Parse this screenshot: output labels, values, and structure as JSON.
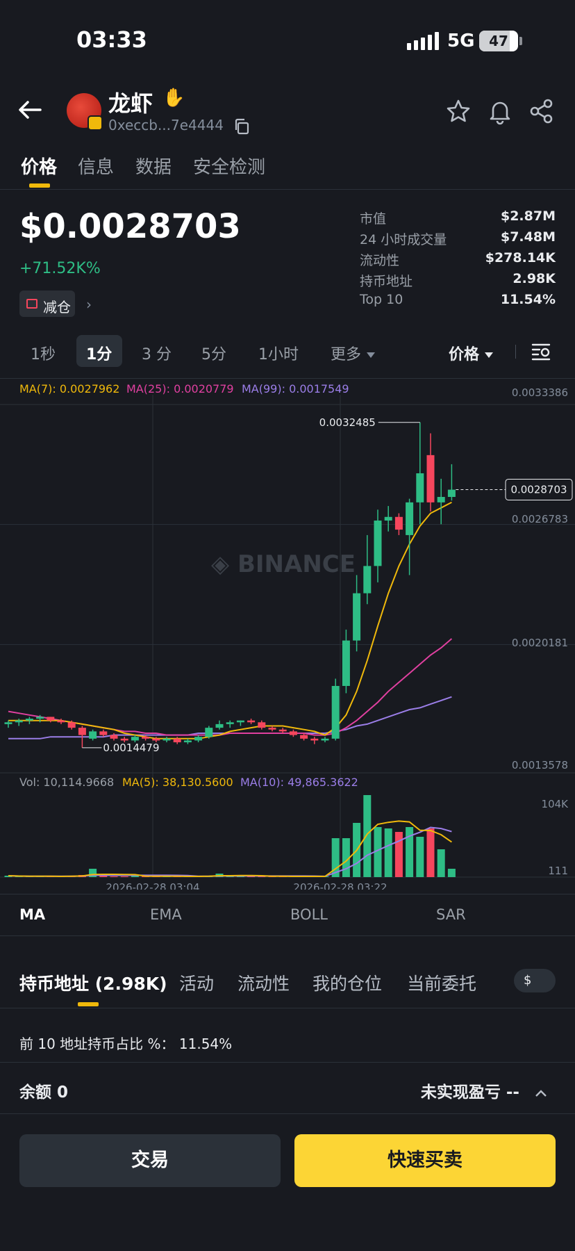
{
  "status": {
    "time": "03:33",
    "network": "5G",
    "battery": "47"
  },
  "token": {
    "name": "龙虾",
    "address": "0xeccb...7e4444"
  },
  "tabs": [
    "价格",
    "信息",
    "数据",
    "安全检测"
  ],
  "price": {
    "value": "$0.0028703",
    "change": "+71.52K%",
    "reduce_label": "减仓"
  },
  "stats": [
    {
      "label": "市值",
      "value": "$2.87M"
    },
    {
      "label": "24 小时成交量",
      "value": "$7.48M"
    },
    {
      "label": "流动性",
      "value": "$278.14K"
    },
    {
      "label": "持币地址",
      "value": "2.98K"
    },
    {
      "label": "Top 10",
      "value": "11.54%"
    }
  ],
  "timeframes": {
    "items": [
      "1秒",
      "1分",
      "3 分",
      "5分",
      "1小时"
    ],
    "more": "更多",
    "price_toggle": "价格"
  },
  "colors": {
    "up": "#2ebd85",
    "down": "#f6465d",
    "accent": "#fcd535",
    "ma7": "#f0b90b",
    "ma25": "#e040a0",
    "ma99": "#9b7ee8"
  },
  "chart_data": {
    "type": "candlestick",
    "ma_legend": {
      "ma7": "MA(7): 0.0027962",
      "ma25": "MA(25): 0.0020779",
      "ma99": "MA(99): 0.0017549"
    },
    "y_ticks": [
      "0.0033386",
      "0.0026783",
      "0.0020181",
      "0.0013578"
    ],
    "y_range": [
      0.0013578,
      0.0033386
    ],
    "current_price": "0.0028703",
    "high_label": "0.0032485",
    "low_label": "0.0014479",
    "watermark": "BINANCE",
    "x_labels": [
      "2026-02-28 03:04",
      "2026-02-28 03:22"
    ],
    "candles": [
      {
        "o": 0.00158,
        "h": 0.0016,
        "l": 0.00156,
        "c": 0.00159
      },
      {
        "o": 0.00159,
        "h": 0.00161,
        "l": 0.00157,
        "c": 0.0016
      },
      {
        "o": 0.0016,
        "h": 0.00162,
        "l": 0.00158,
        "c": 0.00161
      },
      {
        "o": 0.00161,
        "h": 0.00163,
        "l": 0.00159,
        "c": 0.00162
      },
      {
        "o": 0.00162,
        "h": 0.00162,
        "l": 0.00159,
        "c": 0.0016
      },
      {
        "o": 0.0016,
        "h": 0.00161,
        "l": 0.00158,
        "c": 0.00159
      },
      {
        "o": 0.00159,
        "h": 0.0016,
        "l": 0.00155,
        "c": 0.00156
      },
      {
        "o": 0.00156,
        "h": 0.00157,
        "l": 0.00145,
        "c": 0.00152
      },
      {
        "o": 0.0015,
        "h": 0.00155,
        "l": 0.00149,
        "c": 0.00154
      },
      {
        "o": 0.00154,
        "h": 0.00155,
        "l": 0.00151,
        "c": 0.00152
      },
      {
        "o": 0.00152,
        "h": 0.00153,
        "l": 0.00149,
        "c": 0.0015
      },
      {
        "o": 0.0015,
        "h": 0.00151,
        "l": 0.00148,
        "c": 0.00149
      },
      {
        "o": 0.00149,
        "h": 0.00152,
        "l": 0.00148,
        "c": 0.00151
      },
      {
        "o": 0.00151,
        "h": 0.00152,
        "l": 0.00149,
        "c": 0.0015
      },
      {
        "o": 0.0015,
        "h": 0.00151,
        "l": 0.00148,
        "c": 0.00149
      },
      {
        "o": 0.00149,
        "h": 0.00151,
        "l": 0.00148,
        "c": 0.0015
      },
      {
        "o": 0.0015,
        "h": 0.00151,
        "l": 0.00147,
        "c": 0.00148
      },
      {
        "o": 0.00148,
        "h": 0.0015,
        "l": 0.00147,
        "c": 0.00149
      },
      {
        "o": 0.00149,
        "h": 0.00152,
        "l": 0.00148,
        "c": 0.00151
      },
      {
        "o": 0.00151,
        "h": 0.00157,
        "l": 0.0015,
        "c": 0.00156
      },
      {
        "o": 0.00156,
        "h": 0.0016,
        "l": 0.00155,
        "c": 0.00158
      },
      {
        "o": 0.00158,
        "h": 0.0016,
        "l": 0.00156,
        "c": 0.00159
      },
      {
        "o": 0.00159,
        "h": 0.0016,
        "l": 0.00157,
        "c": 0.0016
      },
      {
        "o": 0.0016,
        "h": 0.00161,
        "l": 0.00158,
        "c": 0.00159
      },
      {
        "o": 0.00159,
        "h": 0.0016,
        "l": 0.00155,
        "c": 0.00156
      },
      {
        "o": 0.00156,
        "h": 0.00157,
        "l": 0.00154,
        "c": 0.00155
      },
      {
        "o": 0.00155,
        "h": 0.00156,
        "l": 0.00153,
        "c": 0.00154
      },
      {
        "o": 0.00154,
        "h": 0.00155,
        "l": 0.00151,
        "c": 0.00152
      },
      {
        "o": 0.00152,
        "h": 0.00153,
        "l": 0.00149,
        "c": 0.0015
      },
      {
        "o": 0.0015,
        "h": 0.00151,
        "l": 0.00147,
        "c": 0.00149
      },
      {
        "o": 0.00149,
        "h": 0.00151,
        "l": 0.00148,
        "c": 0.0015
      },
      {
        "o": 0.0015,
        "h": 0.00183,
        "l": 0.00149,
        "c": 0.00179
      },
      {
        "o": 0.00179,
        "h": 0.0021,
        "l": 0.00175,
        "c": 0.00204
      },
      {
        "o": 0.00204,
        "h": 0.0024,
        "l": 0.00198,
        "c": 0.0023
      },
      {
        "o": 0.0023,
        "h": 0.00262,
        "l": 0.00224,
        "c": 0.00245
      },
      {
        "o": 0.00245,
        "h": 0.00276,
        "l": 0.00236,
        "c": 0.0027
      },
      {
        "o": 0.0027,
        "h": 0.00278,
        "l": 0.00264,
        "c": 0.00272
      },
      {
        "o": 0.00272,
        "h": 0.00274,
        "l": 0.00262,
        "c": 0.00265
      },
      {
        "o": 0.00262,
        "h": 0.00282,
        "l": 0.0024,
        "c": 0.0028
      },
      {
        "o": 0.0028,
        "h": 0.00324,
        "l": 0.00268,
        "c": 0.00296
      },
      {
        "o": 0.00306,
        "h": 0.00318,
        "l": 0.00275,
        "c": 0.0028
      },
      {
        "o": 0.0028,
        "h": 0.00293,
        "l": 0.00268,
        "c": 0.00283
      },
      {
        "o": 0.00283,
        "h": 0.00301,
        "l": 0.00281,
        "c": 0.00287
      }
    ],
    "ma7": [
      0.0016,
      0.0016,
      0.0016,
      0.0016,
      0.0016,
      0.0016,
      0.00159,
      0.00158,
      0.00157,
      0.00156,
      0.00155,
      0.00153,
      0.00152,
      0.00151,
      0.0015,
      0.0015,
      0.0015,
      0.0015,
      0.0015,
      0.00151,
      0.00152,
      0.00154,
      0.00155,
      0.00156,
      0.00157,
      0.00157,
      0.00157,
      0.00156,
      0.00155,
      0.00154,
      0.00152,
      0.00156,
      0.00163,
      0.00176,
      0.00193,
      0.00212,
      0.0023,
      0.00245,
      0.00257,
      0.00267,
      0.00274,
      0.00277,
      0.0028
    ],
    "ma25": [
      0.00165,
      0.00164,
      0.00163,
      0.00162,
      0.00161,
      0.0016,
      0.00159,
      0.00158,
      0.00157,
      0.00156,
      0.00155,
      0.00154,
      0.00154,
      0.00153,
      0.00153,
      0.00152,
      0.00152,
      0.00152,
      0.00152,
      0.00152,
      0.00152,
      0.00153,
      0.00153,
      0.00153,
      0.00153,
      0.00153,
      0.00153,
      0.00153,
      0.00153,
      0.00152,
      0.00152,
      0.00153,
      0.00156,
      0.0016,
      0.00165,
      0.0017,
      0.00176,
      0.00181,
      0.00186,
      0.00191,
      0.00196,
      0.002,
      0.00205
    ],
    "ma99": [
      0.0015,
      0.0015,
      0.0015,
      0.0015,
      0.00151,
      0.00151,
      0.00151,
      0.00151,
      0.00151,
      0.00151,
      0.00152,
      0.00152,
      0.00152,
      0.00152,
      0.00152,
      0.00152,
      0.00152,
      0.00152,
      0.00153,
      0.00153,
      0.00153,
      0.00153,
      0.00153,
      0.00153,
      0.00153,
      0.00153,
      0.00153,
      0.00153,
      0.00153,
      0.00153,
      0.00153,
      0.00154,
      0.00155,
      0.00157,
      0.00158,
      0.0016,
      0.00162,
      0.00164,
      0.00166,
      0.00167,
      0.00169,
      0.00171,
      0.00173
    ],
    "volume": {
      "legend": {
        "vol": "Vol: 10,114.9668",
        "ma5": "MA(5): 38,130.5600",
        "ma10": "MA(10): 49,865.3622"
      },
      "y_ticks": [
        "104K",
        "111"
      ],
      "values": [
        2,
        1,
        1,
        1,
        1,
        1,
        2,
        3,
        12,
        2,
        1,
        1,
        2,
        1,
        1,
        1,
        1,
        1,
        1,
        2,
        5,
        1,
        2,
        1,
        1,
        1,
        1,
        1,
        1,
        1,
        1,
        56,
        56,
        78,
        118,
        72,
        70,
        65,
        72,
        58,
        70,
        40,
        12
      ],
      "up": [
        true,
        true,
        true,
        true,
        false,
        false,
        false,
        false,
        true,
        false,
        false,
        false,
        true,
        false,
        false,
        true,
        false,
        true,
        true,
        true,
        true,
        true,
        true,
        false,
        false,
        false,
        false,
        false,
        false,
        false,
        true,
        true,
        true,
        true,
        true,
        true,
        true,
        false,
        true,
        true,
        false,
        true,
        true
      ]
    }
  },
  "indicators": [
    "MA",
    "EMA",
    "BOLL",
    "SAR"
  ],
  "lower_tabs": [
    "持币地址 (2.98K)",
    "活动",
    "流动性",
    "我的仓位",
    "当前委托"
  ],
  "currency_pill": "$",
  "top10_line": "前 10 地址持币占比 %： 11.54%",
  "balance": "余额 0",
  "pnl": "未实现盈亏 --",
  "buttons": {
    "trade": "交易",
    "quick": "快速买卖"
  }
}
